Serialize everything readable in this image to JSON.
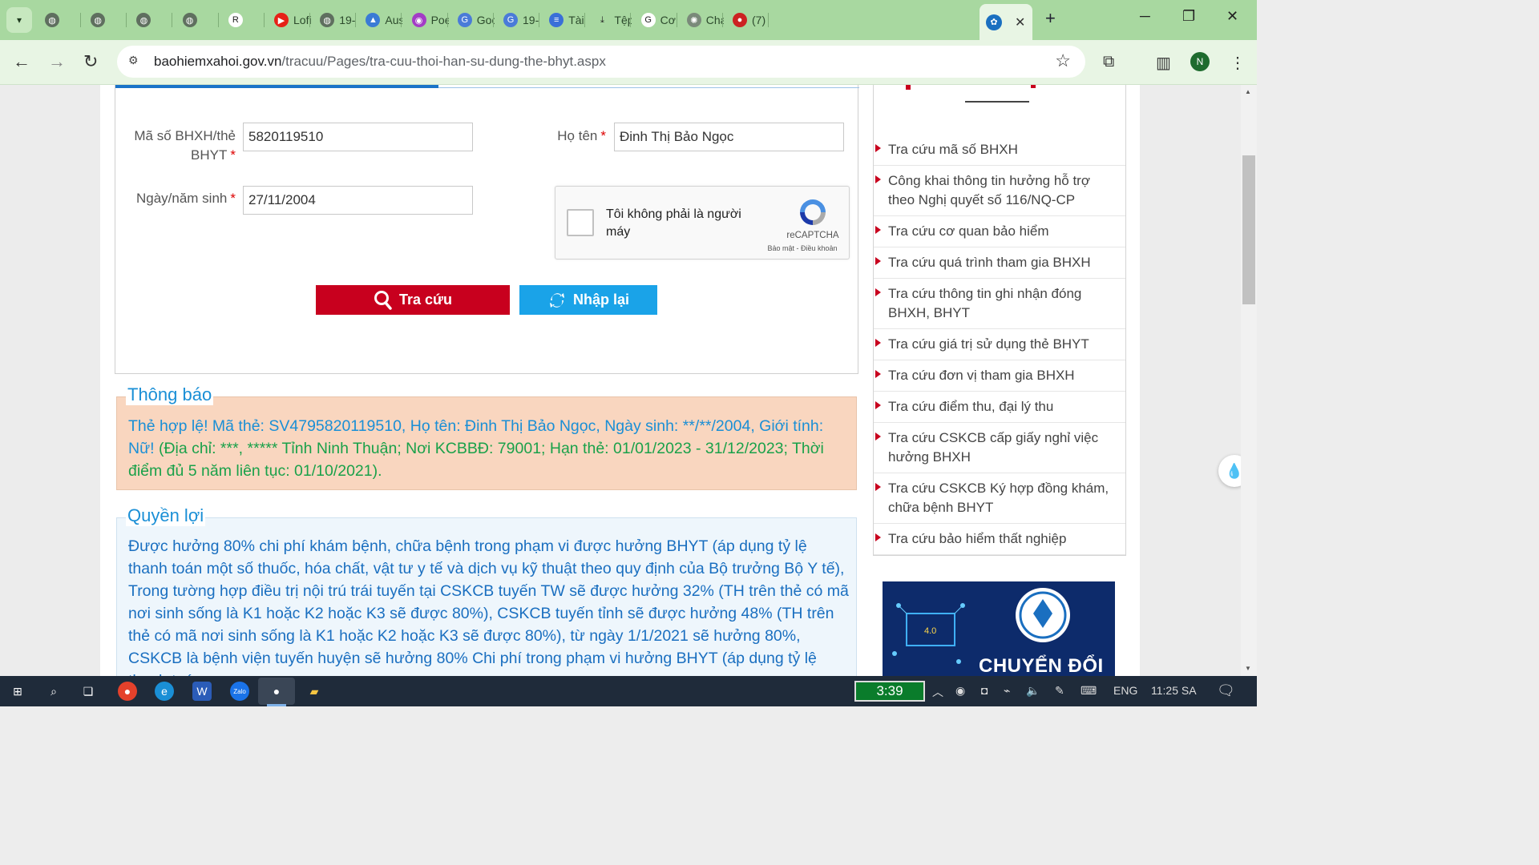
{
  "browser": {
    "tabs": [
      {
        "label": "",
        "icon": "globe-icon"
      },
      {
        "label": "",
        "icon": "globe-icon"
      },
      {
        "label": "",
        "icon": "globe-icon"
      },
      {
        "label": "",
        "icon": "globe-icon"
      },
      {
        "label": "",
        "icon": "r6-icon"
      },
      {
        "label": "Lofi",
        "icon": "youtube-icon"
      },
      {
        "label": "19-",
        "icon": "globe-icon"
      },
      {
        "label": "Aus",
        "icon": "drive-icon"
      },
      {
        "label": "Poe",
        "icon": "poe-icon"
      },
      {
        "label": "Goo",
        "icon": "translate-icon"
      },
      {
        "label": "19-",
        "icon": "translate-icon"
      },
      {
        "label": "Tài",
        "icon": "docs-icon"
      },
      {
        "label": "Tệp",
        "icon": "download-icon"
      },
      {
        "label": "Cơ",
        "icon": "google-icon"
      },
      {
        "label": "Cha",
        "icon": "chatgpt-icon"
      },
      {
        "label": "(7)",
        "icon": "flag-icon"
      }
    ],
    "active_tab_icon": "bhxh-icon",
    "url_host": "baohiemxahoi.gov.vn",
    "url_path": "/tracuu/Pages/tra-cuu-thoi-han-su-dung-the-bhyt.aspx",
    "profile_initial": "N"
  },
  "form": {
    "bhxh_label": "Mã số BHXH/thẻ BHYT",
    "bhxh_value": "5820119510",
    "name_label": "Họ tên",
    "name_value": "Đinh Thị Bảo Ngọc",
    "dob_label": "Ngày/năm sinh",
    "dob_value": "27/11/2004",
    "required_mark": "*",
    "captcha_text": "Tôi không phải là người máy",
    "captcha_brand": "reCAPTCHA",
    "captcha_terms": "Bảo mật - Điều khoản",
    "search_button": "Tra cứu",
    "reset_button": "Nhập lại"
  },
  "notice": {
    "title": "Thông báo",
    "text_blue": "Thẻ hợp lệ! Mã thẻ: SV4795820119510, Họ tên: Đinh Thị Bảo Ngọc, Ngày sinh: **/**/2004, Giới tính: Nữ!",
    "text_green": " (Địa chỉ: ***, ***** Tỉnh Ninh Thuận; Nơi KCBBĐ: 79001; Hạn thẻ: 01/01/2023 - 31/12/2023; Thời điểm đủ 5 năm liên tục: 01/10/2021)."
  },
  "rights": {
    "title": "Quyền lợi",
    "text": "Được hưởng 80% chi phí khám bệnh, chữa bệnh trong phạm vi được hưởng BHYT (áp dụng tỷ lệ thanh toán một số thuốc, hóa chất, vật tư y tế và dịch vụ kỹ thuật theo quy định của Bộ trưởng Bộ Y tế), Trong tường hợp điều trị nội trú trái tuyến tại CSKCB tuyến TW sẽ được hưởng 32% (TH trên thẻ có mã nơi sinh sống là K1 hoặc K2 hoặc K3 sẽ được 80%), CSKCB tuyến tỉnh sẽ được hưởng 48% (TH trên thẻ có mã nơi sinh sống là K1 hoặc K2 hoặc K3 sẽ được 80%), từ ngày 1/1/2021 sẽ hưởng 80%, CSKCB là bệnh viện tuyến huyện sẽ hưởng 80% Chi phí trong phạm vi hưởng BHYT (áp dụng tỷ lệ thanh toán"
  },
  "sidebar": {
    "items": [
      "Tra cứu mã số BHXH",
      "Công khai thông tin hưởng hỗ trợ theo Nghị quyết số 116/NQ-CP",
      "Tra cứu cơ quan bảo hiểm",
      "Tra cứu quá trình tham gia BHXH",
      "Tra cứu thông tin ghi nhận đóng BHXH, BHYT",
      "Tra cứu giá trị sử dụng thẻ BHYT",
      "Tra cứu đơn vị tham gia BHXH",
      "Tra cứu điểm thu, đại lý thu",
      "Tra cứu CSKCB cấp giấy nghỉ việc hưởng BHXH",
      "Tra cứu CSKCB Ký hợp đồng khám, chữa bệnh BHYT",
      "Tra cứu bảo hiểm thất nghiệp"
    ],
    "banner_text": "CHUYỂN ĐỔI SỐ"
  },
  "taskbar": {
    "battery_time": "3:39",
    "language": "ENG",
    "clock": "11:25 SA"
  },
  "colors": {
    "primary_red": "#c8001e",
    "primary_blue": "#1aa3e8",
    "notice_bg": "#f9d6bf",
    "accent_green": "#1aa14a"
  }
}
